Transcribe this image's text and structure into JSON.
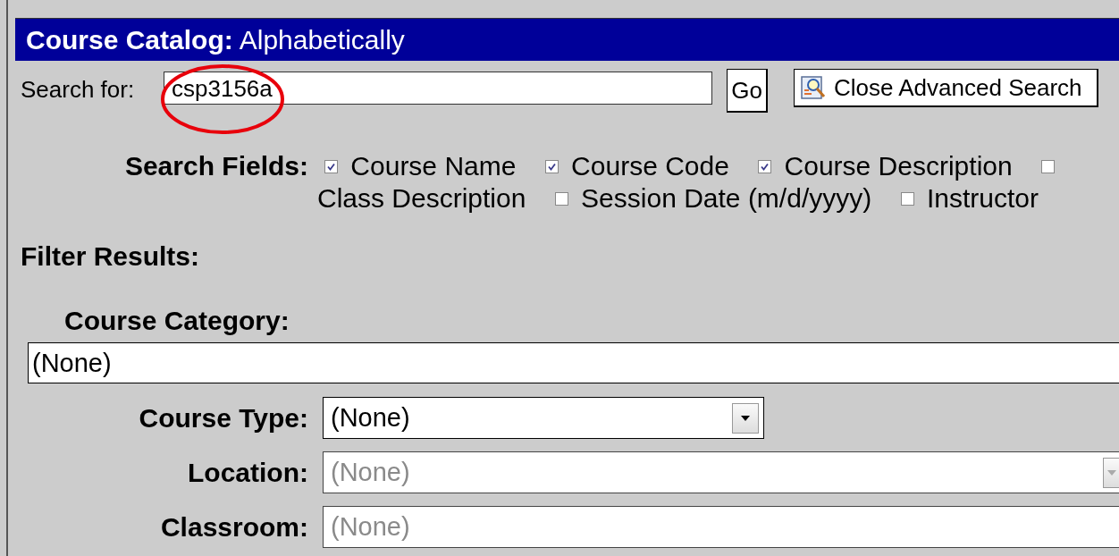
{
  "header": {
    "title": "Course Catalog:",
    "subtitle": "Alphabetically"
  },
  "search": {
    "label": "Search for:",
    "value": "csp3156a",
    "highlighted": true,
    "go_button": "Go",
    "close_button": "Close Advanced Search"
  },
  "search_fields": {
    "label": "Search Fields:",
    "items": [
      {
        "label": "Course Name",
        "checked": true
      },
      {
        "label": "Course Code",
        "checked": true
      },
      {
        "label": "Course Description",
        "checked": true
      },
      {
        "label": "Class Description",
        "checked": false
      },
      {
        "label": "Session Date (m/d/yyyy)",
        "checked": false
      },
      {
        "label": "Instructor",
        "checked": false
      }
    ]
  },
  "filter_heading": "Filter Results:",
  "course_category": {
    "label": "Course Category:",
    "value": "(None)"
  },
  "filters": [
    {
      "kind": "dropdown",
      "label": "Course Type:",
      "value": "(None)",
      "disabled": false
    },
    {
      "kind": "dropdown",
      "label": "Location:",
      "value": "(None)",
      "disabled": true
    },
    {
      "kind": "text",
      "label": "Classroom:",
      "value": "(None)",
      "disabled": true
    }
  ]
}
